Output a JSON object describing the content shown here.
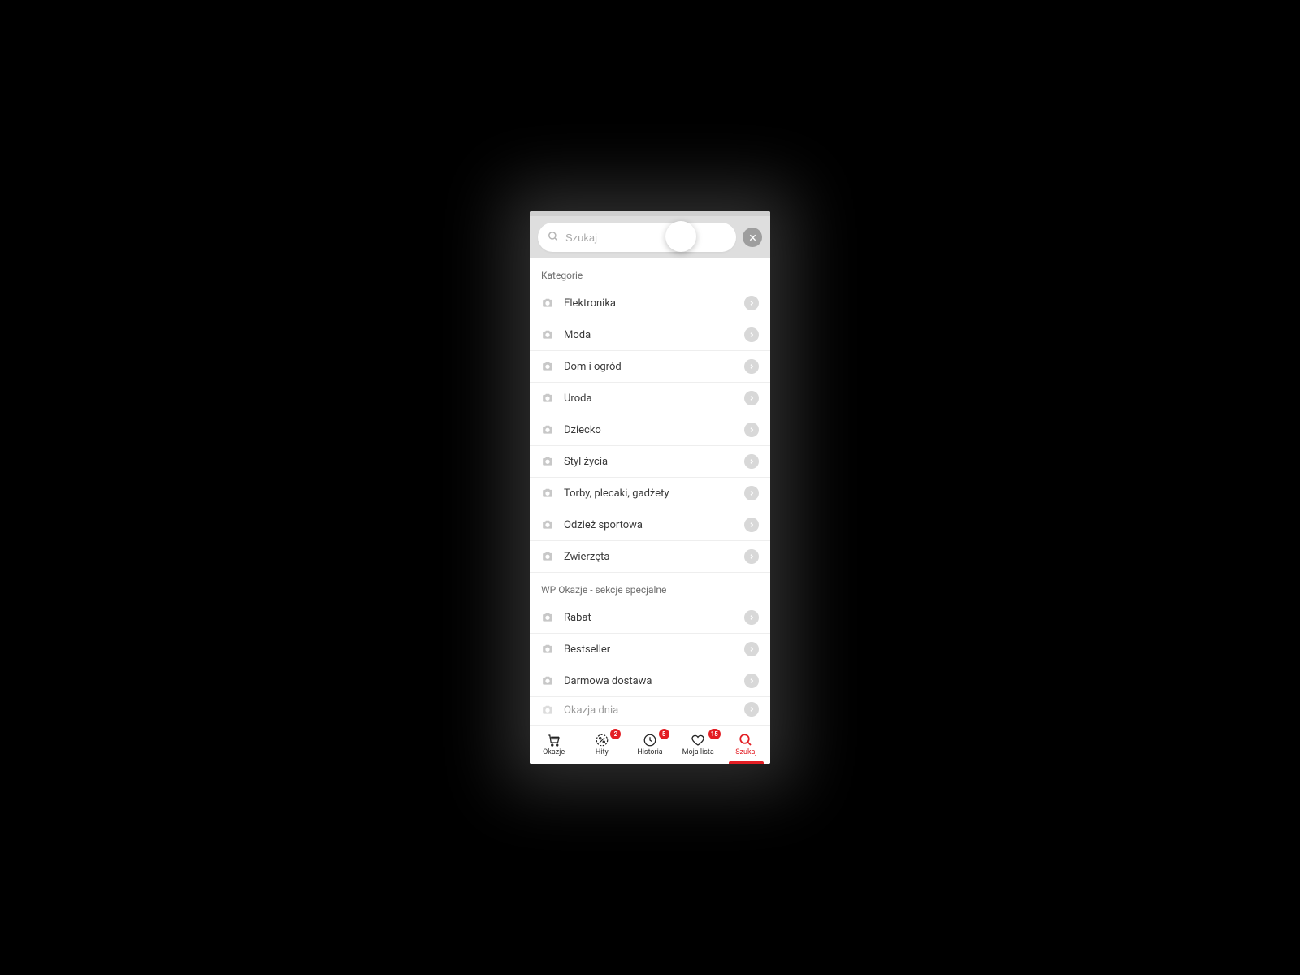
{
  "search": {
    "placeholder": "Szukaj"
  },
  "sections": {
    "categories": {
      "title": "Kategorie",
      "items": [
        {
          "label": "Elektronika"
        },
        {
          "label": "Moda"
        },
        {
          "label": "Dom i ogród"
        },
        {
          "label": "Uroda"
        },
        {
          "label": "Dziecko"
        },
        {
          "label": "Styl życia"
        },
        {
          "label": "Torby, plecaki, gadżety"
        },
        {
          "label": "Odzież sportowa"
        },
        {
          "label": "Zwierzęta"
        }
      ]
    },
    "specials": {
      "title": "WP Okazje - sekcje specjalne",
      "items": [
        {
          "label": "Rabat"
        },
        {
          "label": "Bestseller"
        },
        {
          "label": "Darmowa dostawa"
        },
        {
          "label": "Okazja dnia"
        }
      ]
    }
  },
  "nav": {
    "okazje": {
      "label": "Okazje"
    },
    "hity": {
      "label": "Hity",
      "badge": "2"
    },
    "historia": {
      "label": "Historia",
      "badge": "5"
    },
    "mojalista": {
      "label": "Moja lista",
      "badge": "15"
    },
    "szukaj": {
      "label": "Szukaj"
    }
  }
}
